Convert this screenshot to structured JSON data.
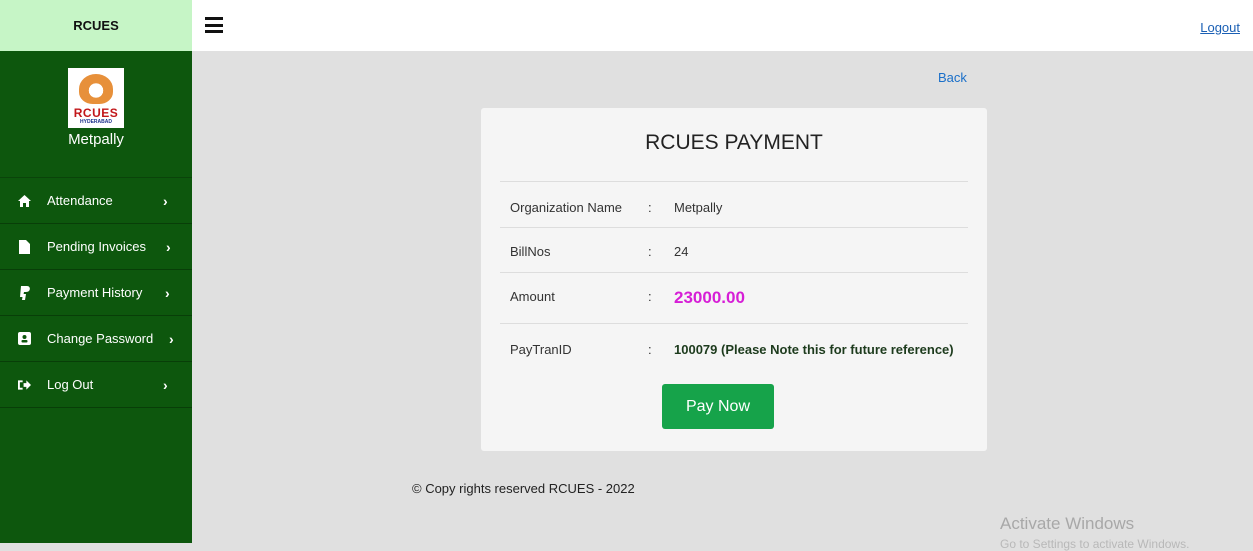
{
  "sidebar": {
    "brand": "RCUES",
    "logo_text": "RCUES",
    "logo_sub": "HYDERABAD",
    "org_name": "Metpally",
    "items": [
      {
        "label": "Attendance",
        "icon": "home-icon"
      },
      {
        "label": "Pending Invoices",
        "icon": "file-icon"
      },
      {
        "label": "Payment History",
        "icon": "paypal-icon"
      },
      {
        "label": "Change Password",
        "icon": "user-card-icon"
      },
      {
        "label": "Log Out",
        "icon": "sign-out-icon"
      }
    ]
  },
  "topbar": {
    "logout": "Logout"
  },
  "back_link": "Back",
  "payment": {
    "title": "RCUES PAYMENT",
    "rows": [
      {
        "label": "Organization Name",
        "colon": ":",
        "value": "Metpally"
      },
      {
        "label": "BillNos",
        "colon": ":",
        "value": "24"
      },
      {
        "label": "Amount",
        "colon": ":",
        "value": "23000.00"
      },
      {
        "label": "PayTranID",
        "colon": ":",
        "value": "100079 (Please Note this for future reference)"
      }
    ],
    "pay_button": "Pay Now"
  },
  "footer": "© Copy rights reserved RCUES - 2022",
  "watermark": {
    "title": "Activate Windows",
    "subtitle": "Go to Settings to activate Windows."
  },
  "colors": {
    "sidebar": "#0d570d",
    "brand_bar": "#c6f5c6",
    "amount": "#d61ed6",
    "pay_button": "#16a34a"
  }
}
